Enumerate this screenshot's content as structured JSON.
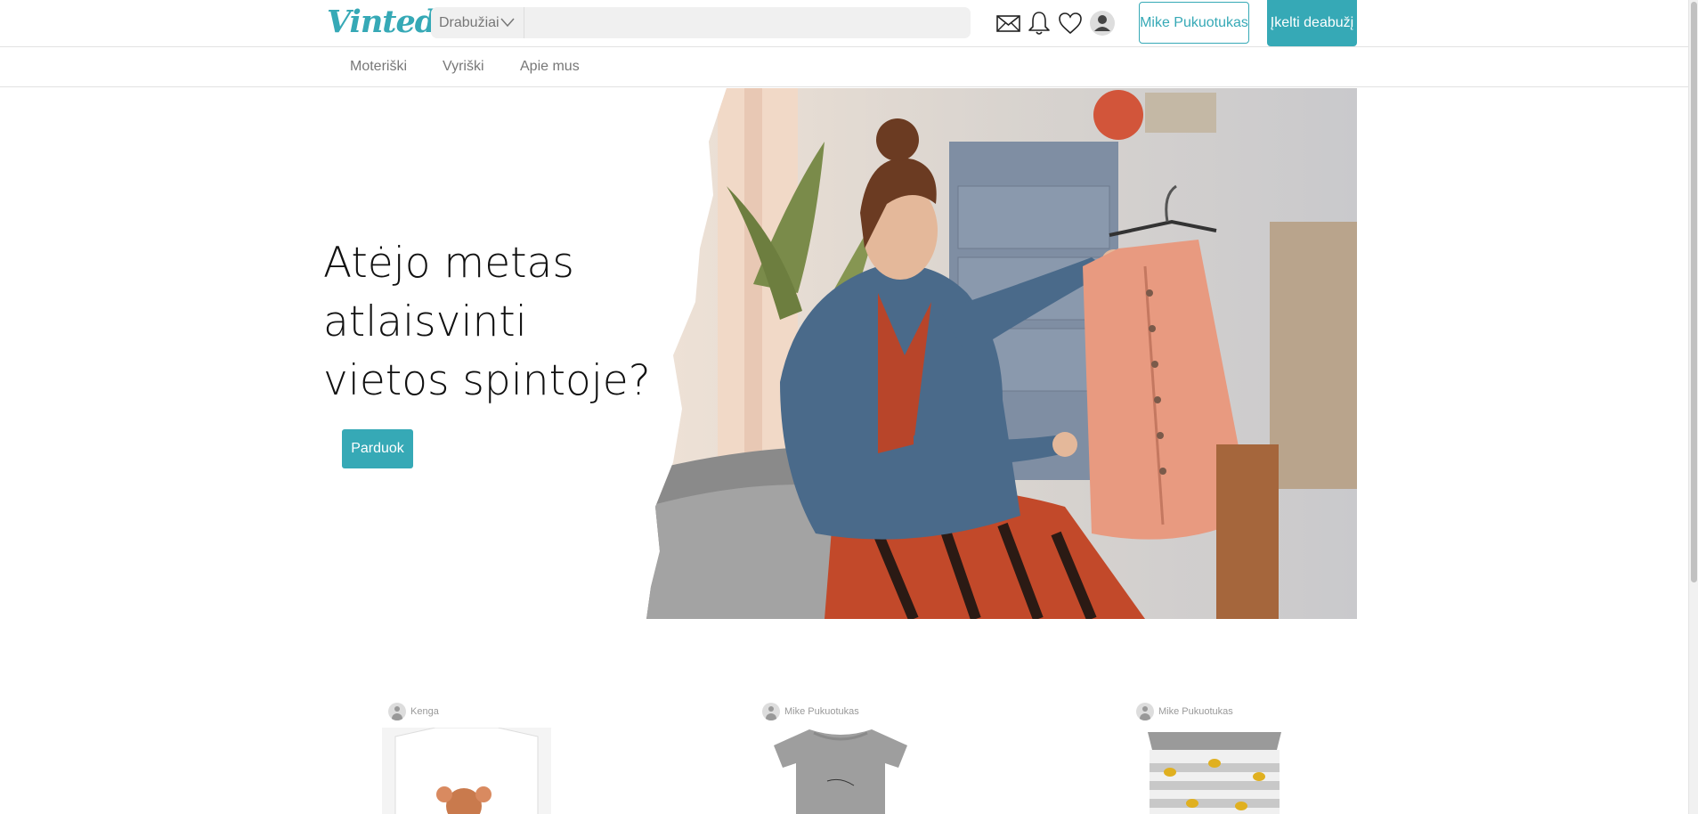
{
  "header": {
    "logo": "Vinted",
    "search": {
      "category": "Drabužiai",
      "value": "",
      "placeholder": ""
    },
    "icons": [
      "mail-icon",
      "bell-icon",
      "heart-icon",
      "user-icon"
    ],
    "profile_label": "Mike Pukuotukas",
    "upload_label": "Įkelti deabužį"
  },
  "nav": {
    "items": [
      "Moteriški",
      "Vyriški",
      "Apie mus"
    ]
  },
  "hero": {
    "title": "Atėjo metas atlaisvinti vietos spintoje?",
    "sell_label": "Parduok"
  },
  "products": [
    {
      "seller": "Kenga"
    },
    {
      "seller": "Mike Pukuotukas"
    },
    {
      "seller": "Mike Pukuotukas"
    }
  ],
  "colors": {
    "accent": "#36a9b6",
    "muted": "#777777"
  }
}
